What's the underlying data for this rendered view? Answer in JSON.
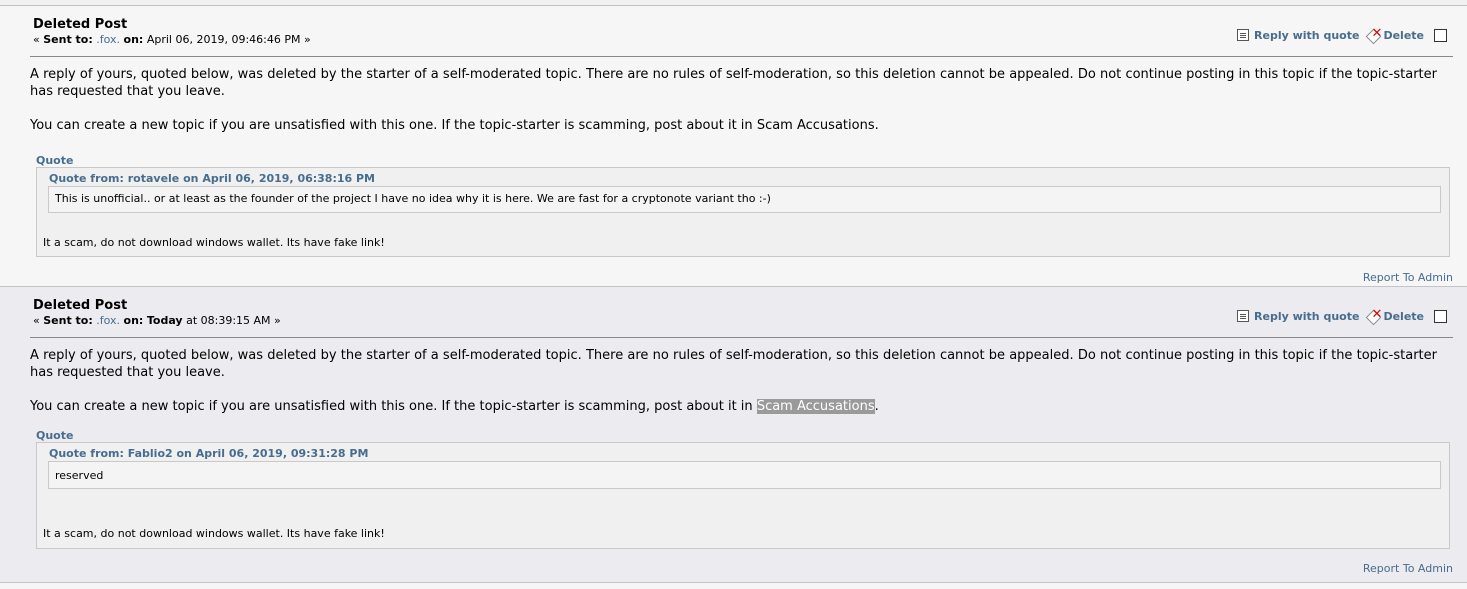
{
  "messages": [
    {
      "subject": "Deleted Post",
      "sent_to_label": "Sent to:",
      "recipient": ".fox.",
      "on_label": "on:",
      "date_bold": "",
      "date_text": "April 06, 2019, 09:46:46 PM",
      "reply_with_quote": "Reply with quote",
      "delete": "Delete",
      "para1": "A reply of yours, quoted below, was deleted by the starter of a self-moderated topic. There are no rules of self-moderation, so this deletion cannot be appealed. Do not continue posting in this topic if the topic-starter has requested that you leave.",
      "para2_prefix": "You can create a new topic if you are unsatisfied with this one. If the topic-starter is scamming, post about it in",
      "para2_link": "Scam Accusations",
      "quote_label": "Quote",
      "quote_from": "Quote from: rotavele on April 06, 2019, 06:38:16 PM",
      "inner_quote": "This is unofficial.. or at least as the founder of the project I have no idea why it is here. We are fast for a cryptonote variant tho :-)",
      "quote_text": "It a scam, do not download windows wallet. Its have fake link!",
      "report": "Report To Admin"
    },
    {
      "subject": "Deleted Post",
      "sent_to_label": "Sent to:",
      "recipient": ".fox.",
      "on_label": "on:",
      "date_bold": "Today",
      "date_text": "at 08:39:15 AM",
      "reply_with_quote": "Reply with quote",
      "delete": "Delete",
      "para1": "A reply of yours, quoted below, was deleted by the starter of a self-moderated topic. There are no rules of self-moderation, so this deletion cannot be appealed. Do not continue posting in this topic if the topic-starter has requested that you leave.",
      "para2_prefix": "You can create a new topic if you are unsatisfied with this one. If the topic-starter is scamming, post about it in",
      "para2_link": "Scam Accusations",
      "quote_label": "Quote",
      "quote_from": "Quote from: Fablio2 on April 06, 2019, 09:31:28 PM",
      "inner_quote": "reserved",
      "quote_text": "It a scam, do not download windows wallet. Its have fake link!",
      "report": "Report To Admin"
    }
  ]
}
